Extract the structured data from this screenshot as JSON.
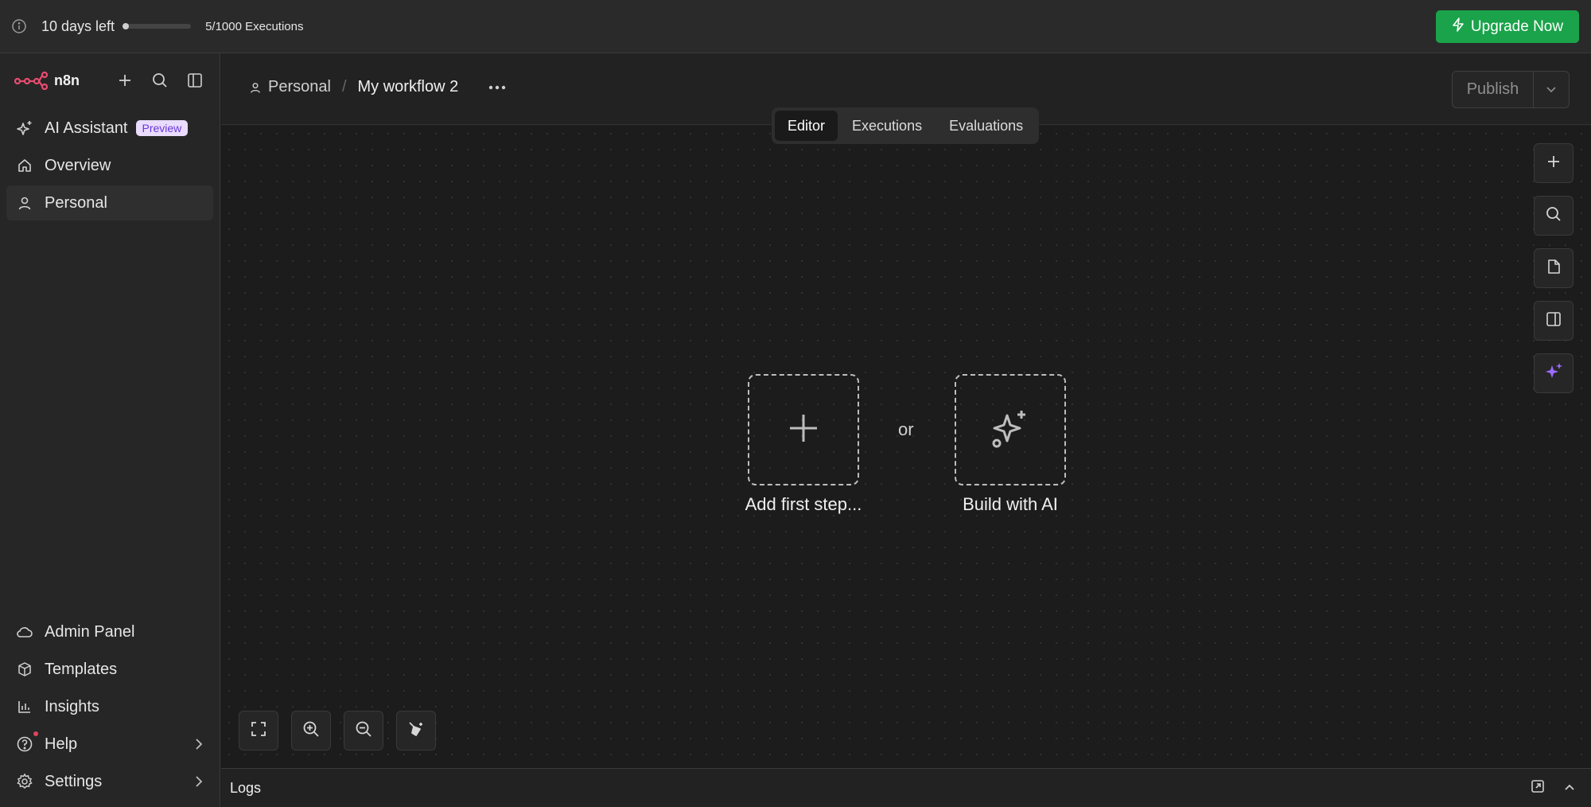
{
  "topbar": {
    "days_left": "10 days left",
    "trial_progress": 0.05,
    "executions": "5/1000 Executions",
    "upgrade_label": "Upgrade Now"
  },
  "sidebar": {
    "brand": "n8n",
    "items": [
      {
        "label": "AI Assistant",
        "badge": "Preview",
        "icon": "sparkle-icon"
      },
      {
        "label": "Overview",
        "icon": "home-icon"
      },
      {
        "label": "Personal",
        "icon": "user-icon",
        "active": true
      }
    ],
    "bottom_items": [
      {
        "label": "Admin Panel",
        "icon": "cloud-icon"
      },
      {
        "label": "Templates",
        "icon": "box-icon"
      },
      {
        "label": "Insights",
        "icon": "chart-icon"
      },
      {
        "label": "Help",
        "icon": "help-icon"
      },
      {
        "label": "Settings",
        "icon": "gear-icon"
      }
    ]
  },
  "header": {
    "project": "Personal",
    "separator": "/",
    "workflow_name": "My workflow 2",
    "publish_label": "Publish"
  },
  "tabs": [
    "Editor",
    "Executions",
    "Evaluations"
  ],
  "canvas": {
    "add_first_step": "Add first step...",
    "or": "or",
    "build_with_ai": "Build with AI"
  },
  "logs": {
    "title": "Logs"
  },
  "colors": {
    "accent_green": "#1aa34a",
    "ai_purple": "#9b6dff",
    "brand_red": "#ea4b71"
  }
}
